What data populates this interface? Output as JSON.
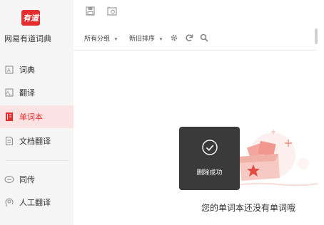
{
  "app": {
    "logo_text": "有道",
    "name": "网易有道词典"
  },
  "sidebar": {
    "items": [
      {
        "label": "词典",
        "icon": "dictionary-icon"
      },
      {
        "label": "翻译",
        "icon": "translate-icon"
      },
      {
        "label": "单词本",
        "icon": "wordbook-icon",
        "active": true
      },
      {
        "label": "文档翻译",
        "icon": "document-icon"
      },
      {
        "label": "同传",
        "icon": "interpretation-icon"
      },
      {
        "label": "人工翻译",
        "icon": "human-translation-icon"
      }
    ]
  },
  "toolbar": {
    "group_filter": "所有分组",
    "sort_filter": "新旧排序",
    "icons": [
      "save-icon",
      "photo-icon",
      "settings-icon",
      "refresh-icon",
      "search-icon"
    ]
  },
  "toast": {
    "message": "删除成功",
    "icon": "check-circle-icon"
  },
  "empty_state": {
    "message": "您的单词本还没有单词哦"
  },
  "colors": {
    "accent": "#e42d2d",
    "active_bg": "#fbe3e3",
    "sidebar_bg": "#f5f5f5",
    "toast_bg": "#3a3a3a"
  }
}
